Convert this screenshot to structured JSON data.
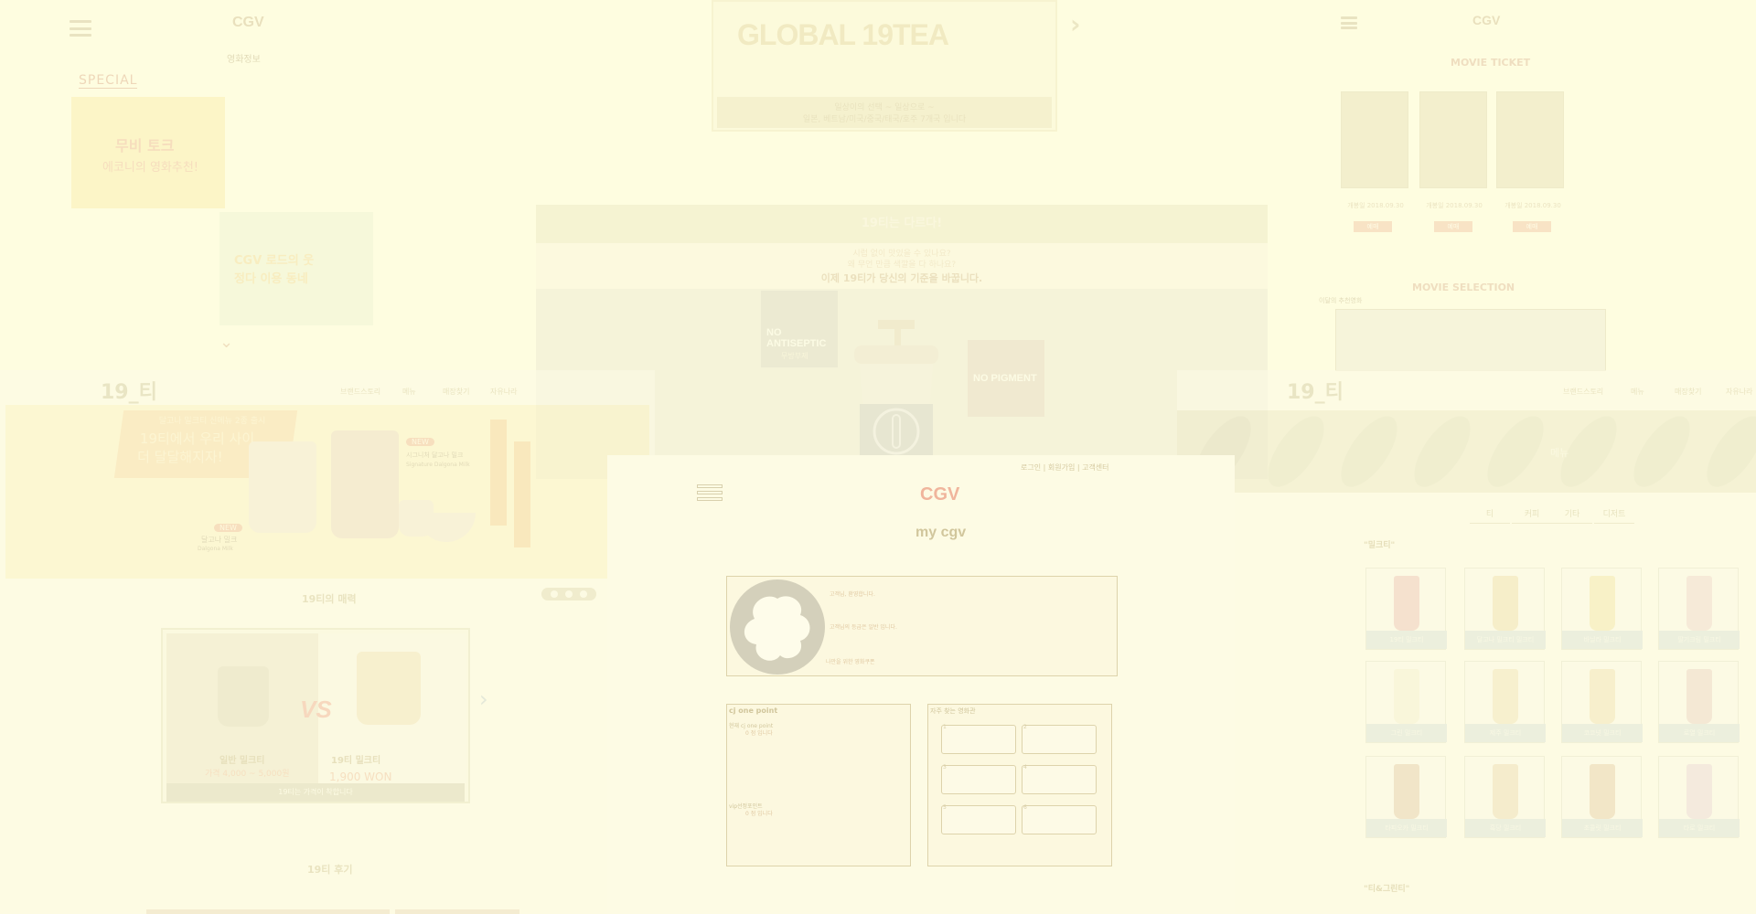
{
  "colors": {
    "background": "#fefde0",
    "cgv_red": "#f0b59c",
    "accent_orange": "#f2bba4"
  },
  "cgv_special": {
    "logo": "CGV",
    "subnav": "영화정보",
    "section_tag": "SPECIAL",
    "card_a_title": "무비 토크",
    "card_a_sub": "에코니의 영화추천!",
    "card_b_line1": "CGV 로드의 웃",
    "card_b_line2": "정다 이용 동네",
    "more_icon": "chevron-down-icon"
  },
  "banner": {
    "headline": "GLOBAL 19TEA",
    "line1": "일상이의 선택 ~ 일상으로 ~",
    "line2": "일본, 베트남/미국/중국/태국/호주 7개국 입니다",
    "next_icon": "chevron-right-icon"
  },
  "tea": {
    "title": "19티는 다르다!",
    "sub1": "시럽 없이 맛있을 수 있나요?",
    "sub2": "왜 무언 만큼 색깔을 다 하나요?",
    "sub3": "이제 19티가 당신의 기준을 바꿉니다.",
    "feature_a": "NO ANTISEPTIC",
    "feature_a_sub": "무방부제",
    "feature_b": "NO PIGMENT"
  },
  "cgv_movie": {
    "logo": "CGV",
    "section1": "MOVIE TICKET",
    "section2": "MOVIE SELECTION",
    "selection_caption": "이달의 추천영화",
    "posters": [
      {
        "caption": "개봉일 2018.09.30",
        "button": "예매"
      },
      {
        "caption": "개봉일 2018.09.30",
        "button": "예매"
      },
      {
        "caption": "개봉일 2018.09.30",
        "button": "예매"
      }
    ]
  },
  "home19": {
    "brand": "19_티",
    "nav": [
      "브랜드스토리",
      "메뉴",
      "매장찾기",
      "자유나라"
    ],
    "hero_small": "달고나 밀크티 신메뉴 2종 출시",
    "hero_line1": "19티에서 우리 사이",
    "hero_line2": "더 달달해지자!",
    "badge_new": "NEW",
    "badge_new2": "NEW",
    "product_a": "달고나 밀크",
    "product_a_en": "Dalgona Milk",
    "product_b": "시그니처 달고나 밀크",
    "product_b_en": "Signature Dalgona Milk",
    "charm_title": "19티의 매력",
    "vs_mark": "VS",
    "vs_left_name": "일반 밀크티",
    "vs_left_price": "가격 4,000 ~ 5,000원",
    "vs_right_name": "19티 밀크티",
    "vs_right_price": "1,900 WON",
    "vs_bar": "19티는 가격이 착합니다",
    "review_title": "19티 후기"
  },
  "menu19": {
    "brand": "19_티",
    "nav": [
      "브랜드스토리",
      "메뉴",
      "매장찾기",
      "자유나라"
    ],
    "hero_label": "메뉴",
    "tabs": [
      "티",
      "커피",
      "기타",
      "디저트"
    ],
    "category1": "\"밀크티\"",
    "category2": "\"티&그린티\"",
    "tiles": [
      "19티 밀크티",
      "달고나 밀크티 밀크티",
      "바닐라 밀크티",
      "딸기크림 밀크티",
      "그린 밀크티",
      "제주 밀크티",
      "코코넛 밀크티",
      "로열 밀크티",
      "타피오카 밀크티",
      "흑당 밀크티",
      "초콜릿 밀크티",
      "타로 밀크티"
    ]
  },
  "mycgv": {
    "top_links": "로그인 | 회원가입 | 고객센터",
    "logo": "CGV",
    "heading": "my cgv",
    "profile_line1": "고객님, 환영합니다.",
    "profile_line2": "고객님의 등급은 일반 입니다.",
    "profile_line3": "나만을 위한 영화쿠폰",
    "cj_title": "cj one point",
    "cj_sub": "현재 cj one point",
    "cj_small": "0 점 입니다",
    "vip_sub": "vip선정포인트",
    "vip_small": "0 점 입니다",
    "fav_title": "자주 찾는 영화관",
    "slots": [
      "1",
      "2",
      "3",
      "4",
      "5",
      "6"
    ]
  }
}
